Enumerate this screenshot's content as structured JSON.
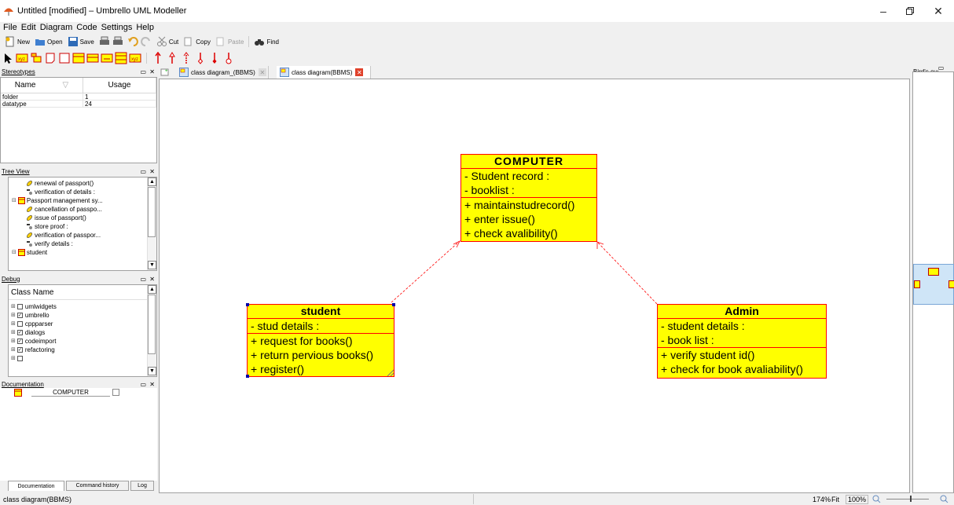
{
  "window": {
    "title": "Untitled [modified] – Umbrello UML Modeller"
  },
  "menu": [
    "File",
    "Edit",
    "Diagram",
    "Code",
    "Settings",
    "Help"
  ],
  "toolbar": {
    "new": "New",
    "open": "Open",
    "save": "Save",
    "cut": "Cut",
    "copy": "Copy",
    "paste": "Paste",
    "find": "Find"
  },
  "docks": {
    "stereotypes": {
      "title": "Stereotypes",
      "columns": [
        "Name",
        "Usage"
      ],
      "rows": [
        {
          "name": "folder",
          "usage": "1"
        },
        {
          "name": "datatype",
          "usage": "24"
        }
      ]
    },
    "tree": {
      "title": "Tree View",
      "items": [
        "renewal of passport()",
        "verification of details :",
        "Passport management sy...",
        "cancellation of passpo...",
        "issue of passport()",
        "store proof :",
        "verification of passpor...",
        "verify details :",
        "student"
      ]
    },
    "debug": {
      "title": "Debug",
      "header": "Class Name",
      "items": [
        {
          "name": "umlwidgets",
          "checked": false
        },
        {
          "name": "umbrello",
          "checked": true
        },
        {
          "name": "cppparser",
          "checked": false
        },
        {
          "name": "dialogs",
          "checked": true
        },
        {
          "name": "codeimport",
          "checked": true
        },
        {
          "name": "refactoring",
          "checked": true
        },
        {
          "name": "",
          "checked": false
        }
      ]
    },
    "documentation": {
      "title": "Documentation",
      "field": "COMPUTER"
    },
    "bottom_tabs": [
      "Documentation",
      "Command history",
      "Log"
    ],
    "birdseye": {
      "title": "Bird's eye"
    }
  },
  "tabs": [
    {
      "label": "class diagram_(BBMS)",
      "active": false
    },
    {
      "label": "class diagram(BBMS)",
      "active": true
    }
  ],
  "classes": {
    "computer": {
      "name": "COMPUTER",
      "attributes": [
        "- Student record :",
        "- booklist :"
      ],
      "operations": [
        "+ maintainstudrecord()",
        "+ enter issue()",
        "+ check avalibility()"
      ]
    },
    "student": {
      "name": "student",
      "attributes": [
        "- stud details :"
      ],
      "operations": [
        "+ request for books()",
        "+ return pervious books()",
        "+ register()"
      ]
    },
    "admin": {
      "name": "Admin",
      "attributes": [
        "- student details :",
        "- book list :"
      ],
      "operations": [
        "+ verify student id()",
        "+ check for book avaliability()"
      ]
    }
  },
  "status": {
    "left": "class diagram(BBMS)",
    "zoom": "174%",
    "fit": "Fit",
    "zoom100": "100%"
  },
  "colors": {
    "class_fill": "#ffff00",
    "class_border": "#ff0000",
    "association": "#ff0000"
  }
}
